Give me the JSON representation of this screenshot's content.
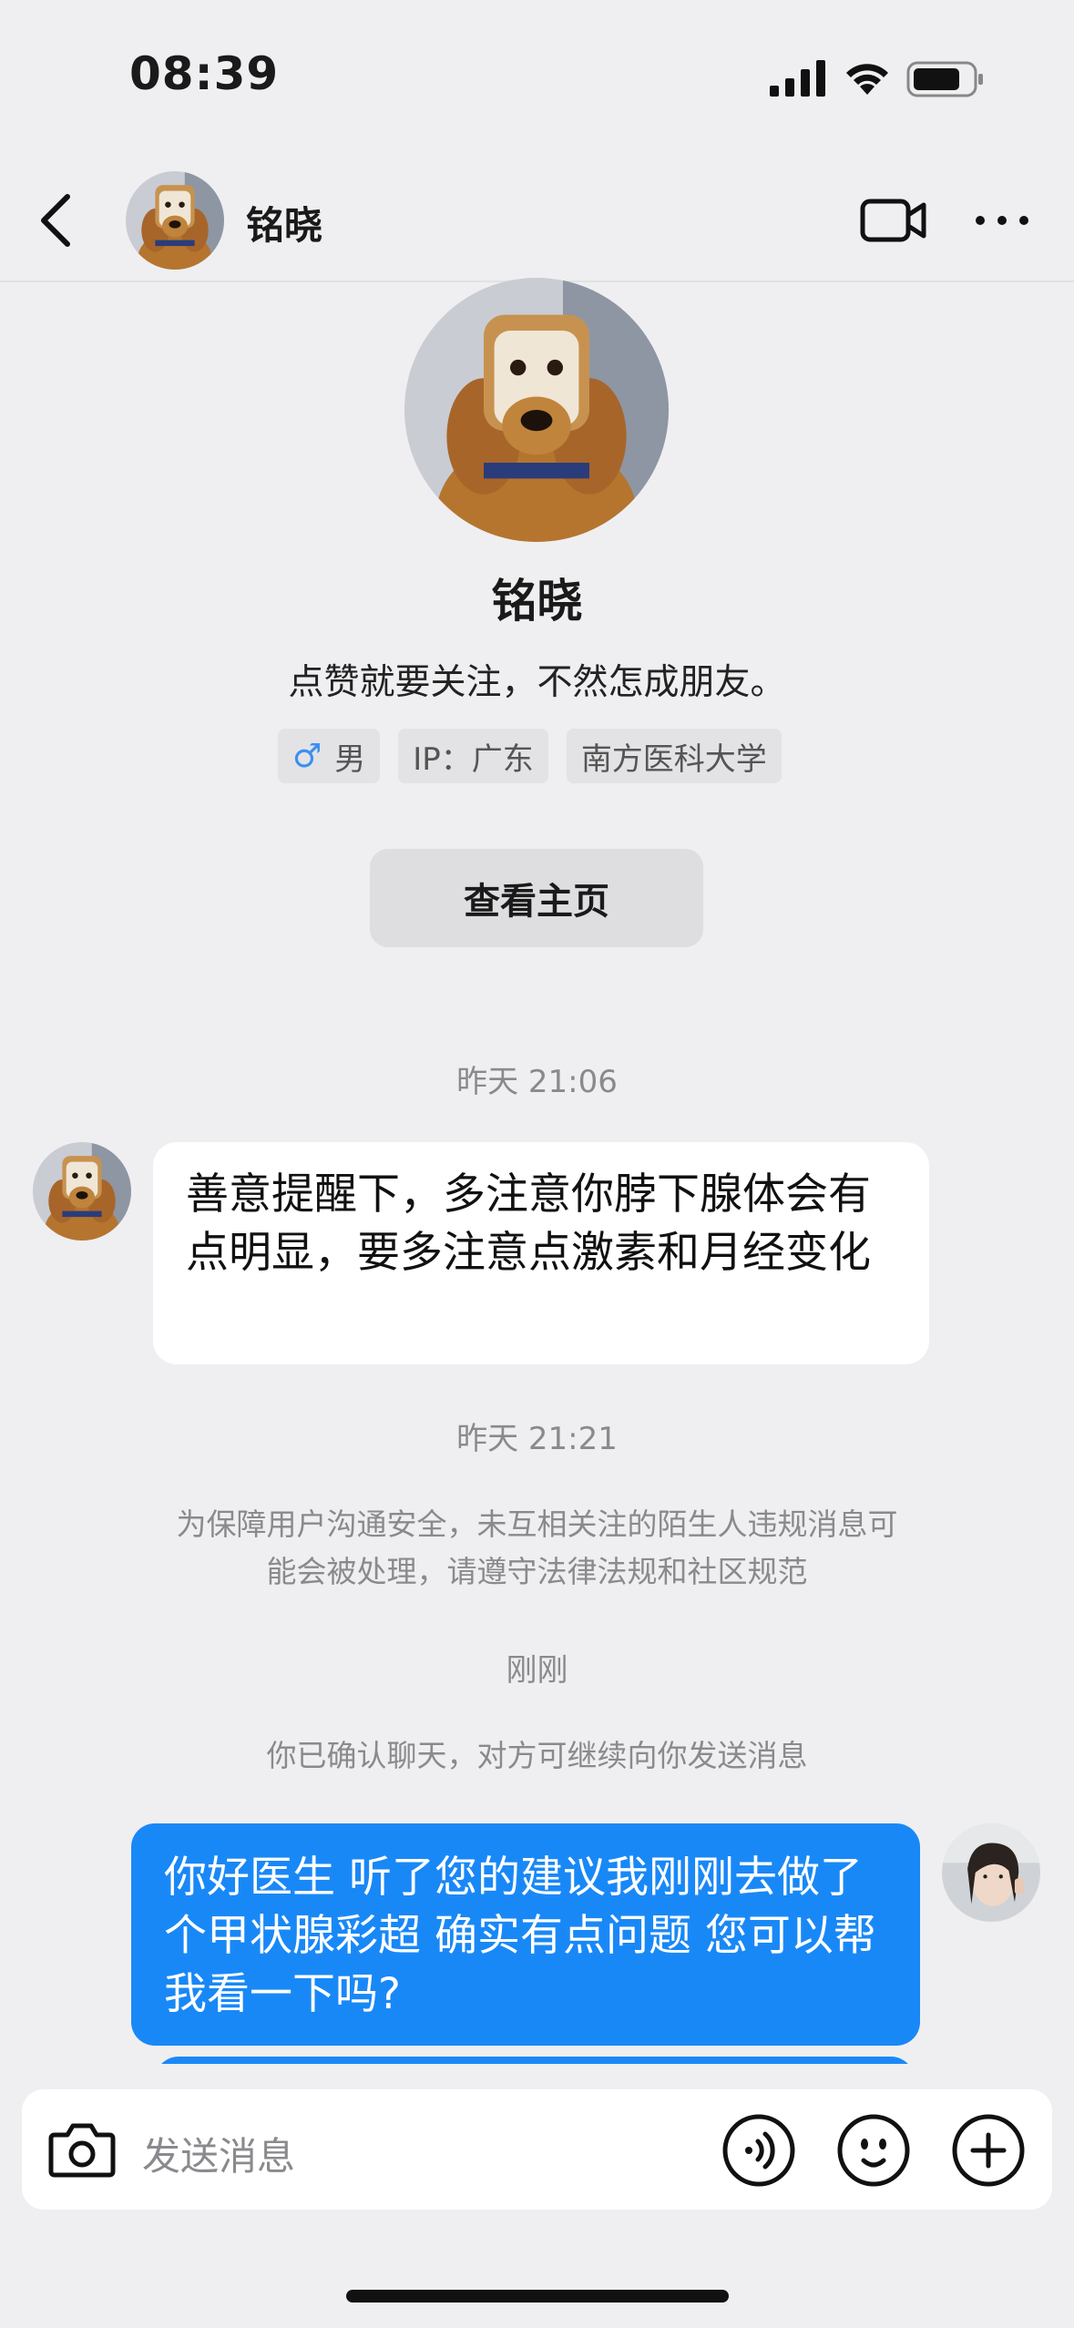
{
  "status_bar": {
    "time": "08:39"
  },
  "header": {
    "name": "铭晓"
  },
  "profile": {
    "name": "铭晓",
    "bio": "点赞就要关注，不然怎成朋友。",
    "tags": {
      "gender_symbol": "♂",
      "gender": "男",
      "ip": "IP：广东",
      "school": "南方医科大学"
    },
    "view_button": "查看主页"
  },
  "chat": {
    "timestamp_1": "昨天 21:06",
    "message_1": "善意提醒下，多注意你脖下腺体会有点明显，要多注意点激素和月经变化",
    "timestamp_2": "昨天 21:21",
    "notice_line_1": "为保障用户沟通安全，未互相关注的陌生人违规消息可",
    "notice_line_2": "能会被处理，请遵守法律法规和社区规范",
    "timestamp_3": "刚刚",
    "confirm_notice": "你已确认聊天，对方可继续向你发送消息",
    "message_2": "你好医生 听了您的建议我刚刚去做了个甲状腺彩超 确实有点问题 您可以帮我看一下吗?"
  },
  "input": {
    "placeholder": "发送消息"
  },
  "colors": {
    "accent": "#1988f7",
    "background": "#efeff1",
    "bubble_in": "#ffffff"
  }
}
